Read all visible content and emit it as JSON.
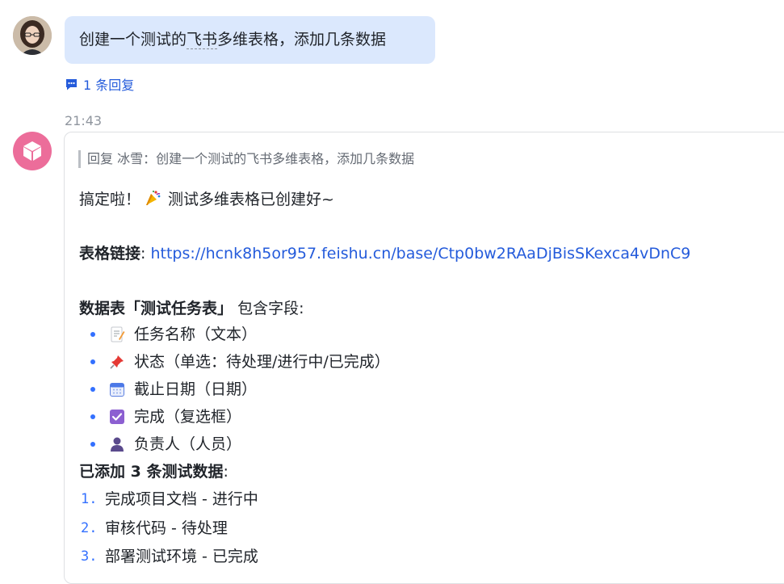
{
  "user_message": {
    "text_before": "创建一个测试的",
    "text_dashed": "飞书",
    "text_after": "多维表格，添加几条数据"
  },
  "reply_count_label": "1 条回复",
  "time": "21:43",
  "bot_message": {
    "quote": "回复 冰雪：创建一个测试的飞书多维表格，添加几条数据",
    "greeting": "搞定啦！",
    "greeting_after": "测试多维表格已创建好~",
    "link_label": "表格链接",
    "link_colon": ":",
    "link_url": "https://hcnk8h5or957.feishu.cn/base/Ctp0bw2RAaDjBisSKexca4vDnC9",
    "table_heading": "数据表「测试任务表」",
    "table_heading_after": "包含字段:",
    "fields": [
      {
        "icon": "memo-icon",
        "text": "任务名称（文本）"
      },
      {
        "icon": "pushpin-icon",
        "text": "状态（单选：待处理/进行中/已完成）"
      },
      {
        "icon": "calendar-icon",
        "text": "截止日期（日期）"
      },
      {
        "icon": "checkbox-icon",
        "text": "完成（复选框）"
      },
      {
        "icon": "person-icon",
        "text": "负责人（人员）"
      }
    ],
    "records_heading": "已添加 3 条测试数据",
    "records_colon": ":",
    "records": [
      {
        "num": "1.",
        "text": "完成项目文档 - 进行中"
      },
      {
        "num": "2.",
        "text": "审核代码 - 待处理"
      },
      {
        "num": "3.",
        "text": "部署测试环境 - 已完成"
      }
    ]
  },
  "colors": {
    "user_bubble": "#dbe8fd",
    "link": "#245bdb",
    "bullet": "#3370ff",
    "bot_avatar": "#ec6d9a"
  }
}
